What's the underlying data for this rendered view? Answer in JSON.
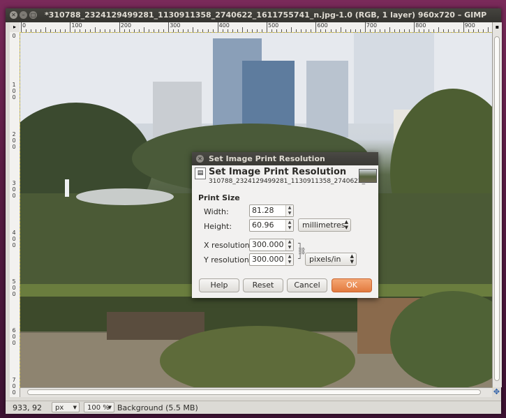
{
  "window": {
    "title": "*310788_2324129499281_1130911358_2740622_1611755741_n.jpg-1.0 (RGB, 1 layer) 960x720 – GIMP"
  },
  "ruler": {
    "top_labels": [
      "0",
      "100",
      "200",
      "300",
      "400",
      "500",
      "600",
      "700",
      "800",
      "900"
    ],
    "left_labels": [
      "0",
      "100",
      "200",
      "300",
      "400",
      "500",
      "600",
      "700"
    ]
  },
  "status": {
    "coords": "933, 92",
    "unit": "px",
    "zoom": "100 %",
    "layer": "Background (5.5 MB)"
  },
  "dialog": {
    "title": "Set Image Print Resolution",
    "heading": "Set Image Print Resolution",
    "subtitle": "310788_2324129499281_1130911358_2740622_1...",
    "section": "Print Size",
    "width_label": "Width:",
    "width_value": "81.28",
    "height_label": "Height:",
    "height_value": "60.96",
    "size_unit": "millimetres",
    "xres_label": "X resolution:",
    "xres_value": "300.000",
    "yres_label": "Y resolution:",
    "yres_value": "300.000",
    "res_unit": "pixels/in",
    "buttons": {
      "help": "Help",
      "reset": "Reset",
      "cancel": "Cancel",
      "ok": "OK"
    }
  },
  "colors": {
    "ok_button": "#e27a3f",
    "titlebar": "#3c3b37",
    "desktop": "#5a1c44"
  }
}
